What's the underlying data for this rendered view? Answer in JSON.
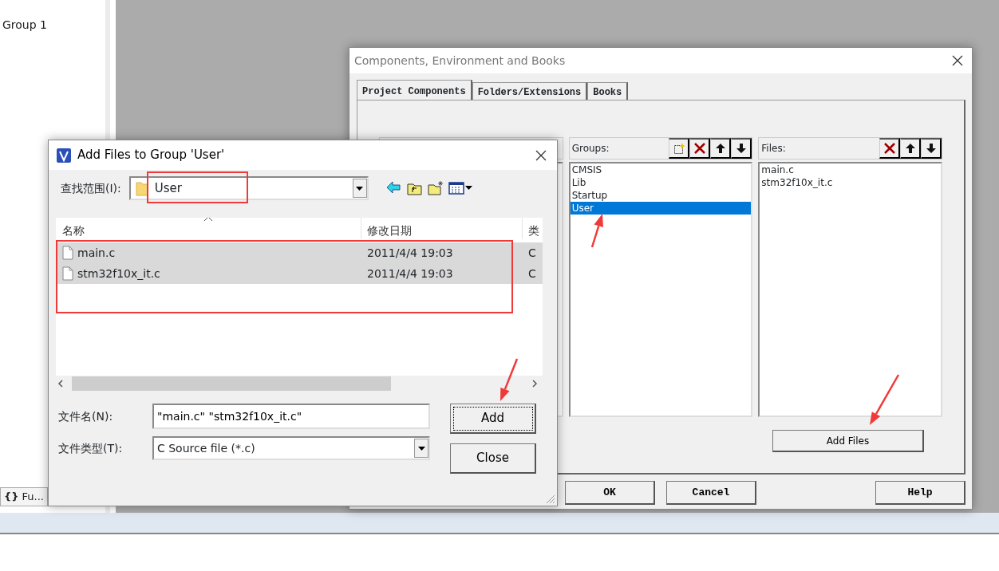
{
  "background": {
    "groups": [
      {
        "label": "Group 1"
      }
    ],
    "bottom_tab": {
      "icon_text": "{}",
      "label": "Fu..."
    }
  },
  "components_dialog": {
    "title": "Components, Environment and Books",
    "tabs": [
      {
        "label": "Project Components",
        "selected": true
      },
      {
        "label": "Folders/Extensions",
        "selected": false
      },
      {
        "label": "Books",
        "selected": false
      }
    ],
    "groups": {
      "label": "Groups:",
      "items": [
        {
          "label": "CMSIS",
          "selected": false
        },
        {
          "label": "Lib",
          "selected": false
        },
        {
          "label": "Startup",
          "selected": false
        },
        {
          "label": "User",
          "selected": true
        }
      ]
    },
    "files": {
      "label": "Files:",
      "items": [
        {
          "label": "main.c"
        },
        {
          "label": "stm32f10x_it.c"
        }
      ]
    },
    "add_files_button": "Add Files",
    "buttons": [
      "OK",
      "Cancel",
      "Help"
    ]
  },
  "add_dialog": {
    "title": "Add Files to Group 'User'",
    "look_in": {
      "label": "查找范围(I):",
      "value": "User"
    },
    "columns": [
      "名称",
      "修改日期",
      "类"
    ],
    "rows": [
      {
        "name": "main.c",
        "modified": "2011/4/4 19:03",
        "column_3": "C",
        "selected": true
      },
      {
        "name": "stm32f10x_it.c",
        "modified": "2011/4/4 19:03",
        "column_3": "C",
        "selected": true
      }
    ],
    "file_name": {
      "label": "文件名(N):",
      "value": "\"main.c\" \"stm32f10x_it.c\""
    },
    "file_type": {
      "label": "文件类型(T):",
      "value": "C Source file (*.c)"
    },
    "buttons": [
      {
        "label": "Add",
        "focused": true
      },
      {
        "label": "Close",
        "focused": false
      }
    ]
  }
}
